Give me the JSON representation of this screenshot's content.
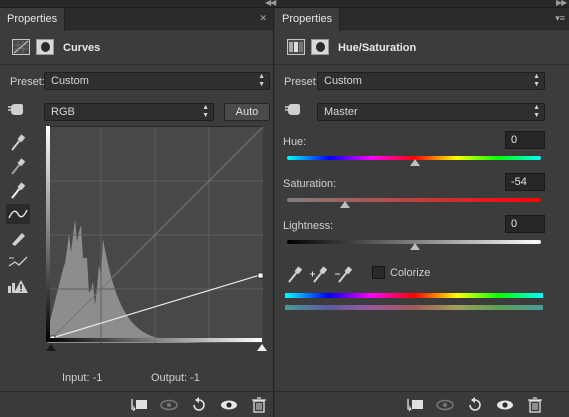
{
  "left_panel": {
    "tab_label": "Properties",
    "title": "Curves",
    "preset_label": "Preset:",
    "preset_value": "Custom",
    "channel_value": "RGB",
    "auto_label": "Auto",
    "input_label": "Input: -1",
    "output_label": "Output: -1"
  },
  "right_panel": {
    "tab_label": "Properties",
    "title": "Hue/Saturation",
    "preset_label": "Preset:",
    "preset_value": "Custom",
    "range_value": "Master",
    "hue_label": "Hue:",
    "hue_value": "0",
    "saturation_label": "Saturation:",
    "saturation_value": "-54",
    "lightness_label": "Lightness:",
    "lightness_value": "0",
    "colorize_label": "Colorize"
  },
  "colors": {
    "panel_bg": "#3c3c3c",
    "curve": "#e8e8e8",
    "histogram": "#9a9a9a"
  }
}
